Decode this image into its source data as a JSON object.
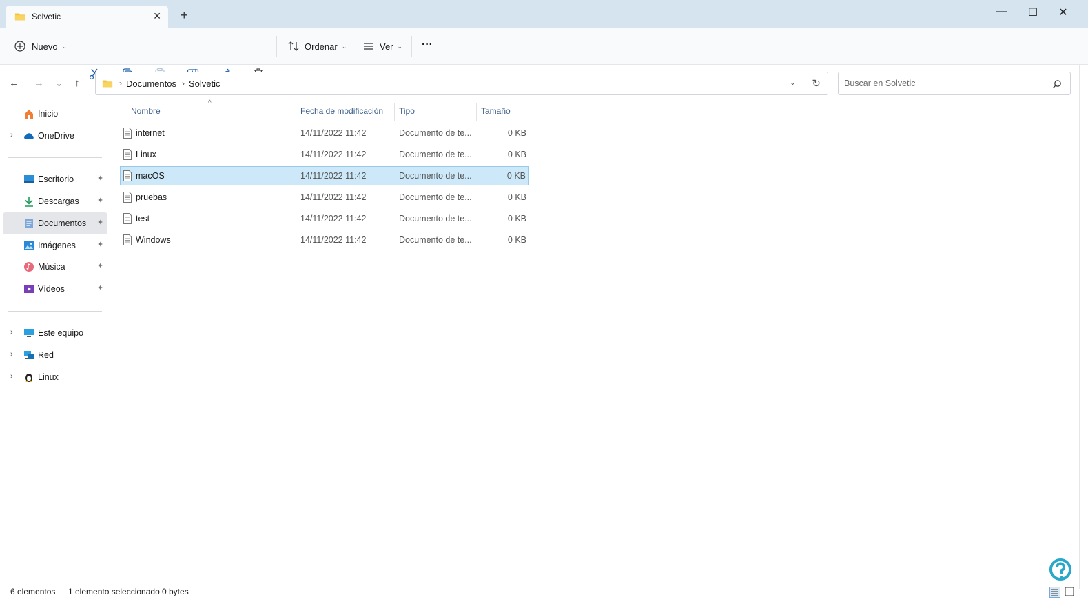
{
  "window": {
    "tab_title": "Solvetic",
    "tab_close": "✕",
    "new_tab": "+",
    "minimize": "—",
    "maximize": "☐",
    "close": "✕"
  },
  "toolbar": {
    "new_label": "Nuevo",
    "sort_label": "Ordenar",
    "view_label": "Ver",
    "more_label": "···"
  },
  "address": {
    "crumbs": [
      "Documentos",
      "Solvetic"
    ]
  },
  "search": {
    "placeholder": "Buscar en Solvetic"
  },
  "sidebar": {
    "top": [
      {
        "label": "Inicio",
        "icon": "home-icon"
      },
      {
        "label": "OneDrive",
        "icon": "cloud-icon"
      }
    ],
    "quick": [
      {
        "label": "Escritorio",
        "icon": "desktop-icon"
      },
      {
        "label": "Descargas",
        "icon": "download-icon"
      },
      {
        "label": "Documentos",
        "icon": "documents-icon"
      },
      {
        "label": "Imágenes",
        "icon": "pictures-icon"
      },
      {
        "label": "Música",
        "icon": "music-icon"
      },
      {
        "label": "Vídeos",
        "icon": "videos-icon"
      }
    ],
    "bottom": [
      {
        "label": "Este equipo",
        "icon": "computer-icon"
      },
      {
        "label": "Red",
        "icon": "network-icon"
      },
      {
        "label": "Linux",
        "icon": "linux-icon"
      }
    ],
    "pin_glyph": "📌"
  },
  "columns": {
    "name": "Nombre",
    "date": "Fecha de modificación",
    "type": "Tipo",
    "size": "Tamaño"
  },
  "files": [
    {
      "name": "internet",
      "date": "14/11/2022 11:42",
      "type": "Documento de te...",
      "size": "0 KB"
    },
    {
      "name": "Linux",
      "date": "14/11/2022 11:42",
      "type": "Documento de te...",
      "size": "0 KB"
    },
    {
      "name": "macOS",
      "date": "14/11/2022 11:42",
      "type": "Documento de te...",
      "size": "0 KB"
    },
    {
      "name": "pruebas",
      "date": "14/11/2022 11:42",
      "type": "Documento de te...",
      "size": "0 KB"
    },
    {
      "name": "test",
      "date": "14/11/2022 11:42",
      "type": "Documento de te...",
      "size": "0 KB"
    },
    {
      "name": "Windows",
      "date": "14/11/2022 11:42",
      "type": "Documento de te...",
      "size": "0 KB"
    }
  ],
  "status": {
    "count": "6 elementos",
    "selection": "1 elemento seleccionado",
    "bytes": "0 bytes"
  },
  "colors": {
    "selected_row": "#cce8f9",
    "accent": "#0067c0",
    "folder": "#f4c542"
  }
}
